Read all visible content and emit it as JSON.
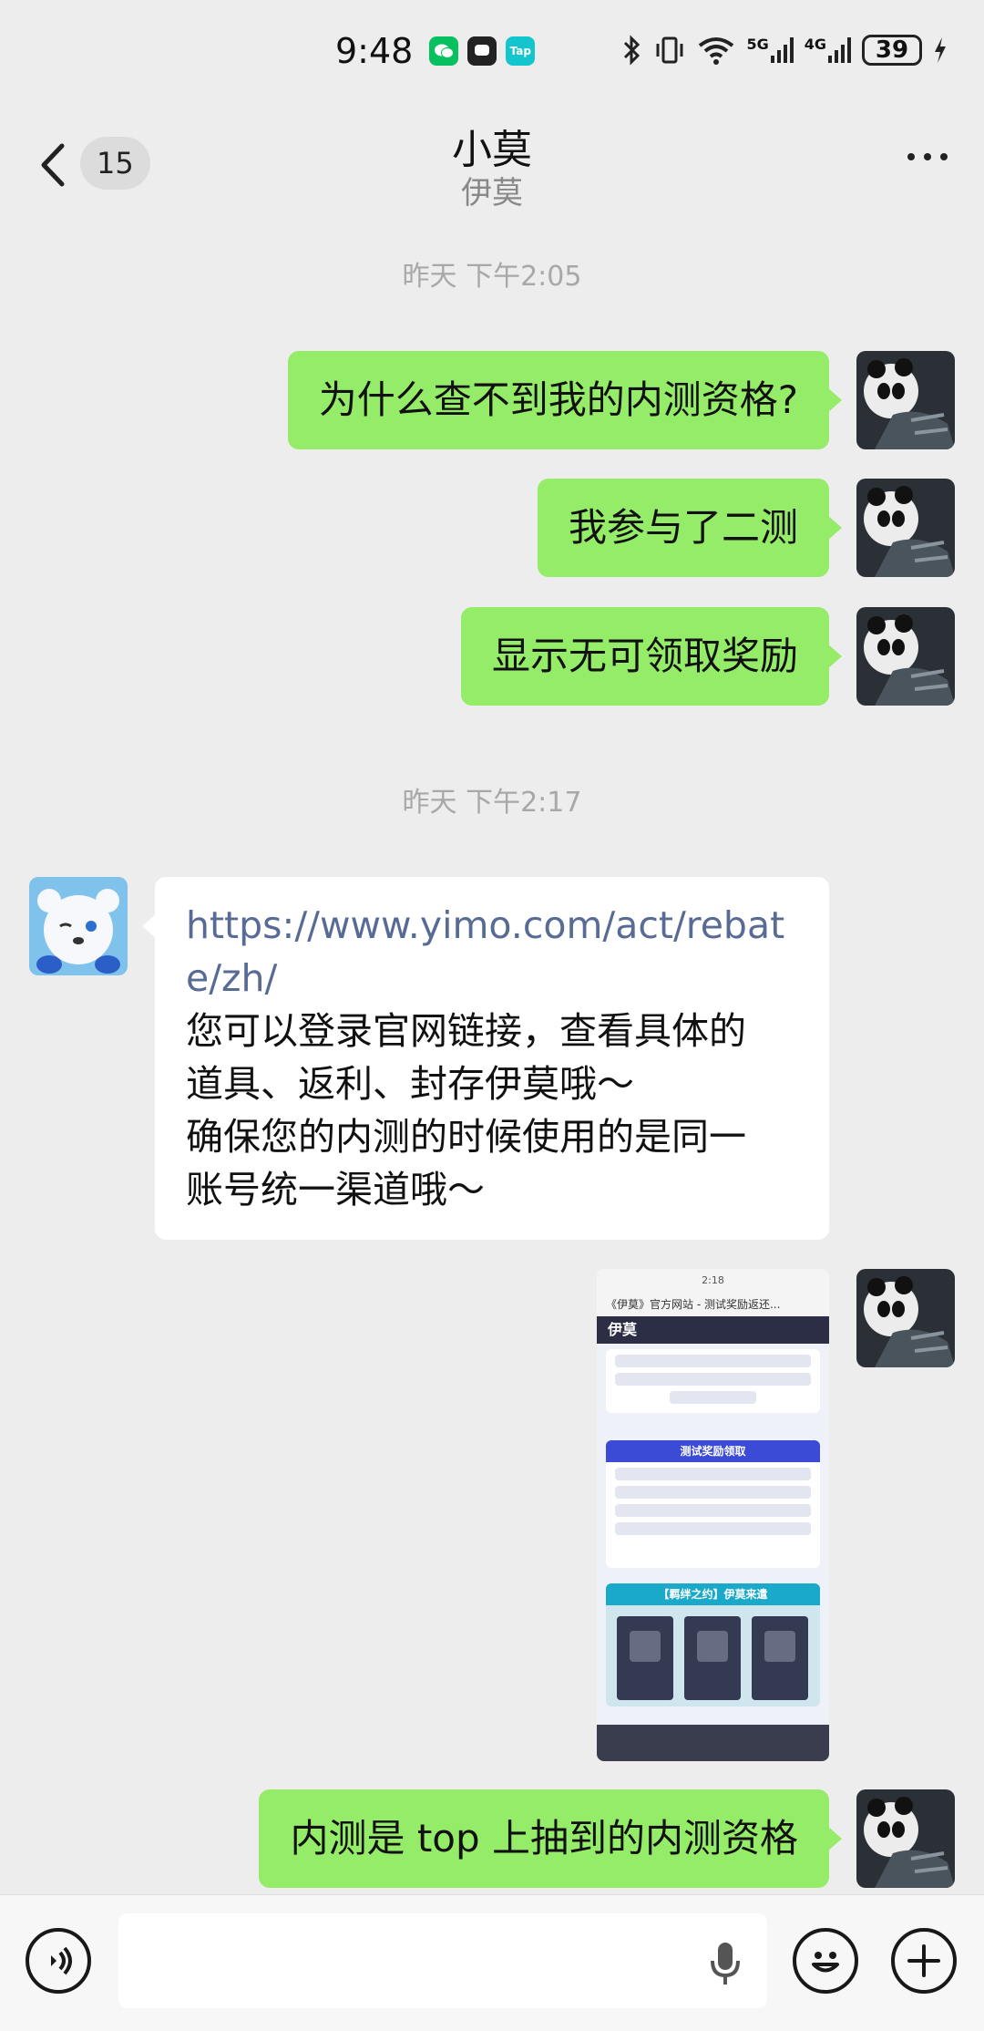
{
  "status_bar": {
    "time": "9:48",
    "app_badges": [
      {
        "name": "wechat-badge-icon",
        "color": "#07c160",
        "label": ""
      },
      {
        "name": "message-badge-icon",
        "color": "#222222",
        "label": ""
      },
      {
        "name": "taptap-badge-icon",
        "color": "#15c5ce",
        "label": "Tap"
      }
    ],
    "network_1": "5G",
    "network_2": "4G",
    "battery": "39"
  },
  "header": {
    "unread_count": "15",
    "title": "小莫",
    "subtitle": "伊莫"
  },
  "messages": {
    "time_1": "昨天 下午2:05",
    "out_1": "为什么查不到我的内测资格?",
    "out_2": "我参与了二测",
    "out_3": "显示无可领取奖励",
    "time_2": "昨天 下午2:17",
    "in_1": {
      "link": "https://www.yimo.com/act/rebate/zh/",
      "line_1": "您可以登录官网链接，查看具体的",
      "line_2": "道具、返利、封存伊莫哦～",
      "line_3": "确保您的内测的时候使用的是同一",
      "line_4": "账号统一渠道哦～"
    },
    "screenshot": {
      "status_time": "2:18",
      "title": "《伊莫》官方网站 - 测试奖励返还...",
      "brand": "伊莫",
      "panel_1_title": "测试奖励领取",
      "panel_2_title": "【羁绊之约】伊莫来遣"
    },
    "out_4": "内测是 top 上抽到的内测资格"
  },
  "colors": {
    "background": "#ededed",
    "bubble_out": "#95ec69",
    "bubble_in": "#ffffff",
    "link": "#576b95",
    "timestamp": "#a8a8a8"
  }
}
